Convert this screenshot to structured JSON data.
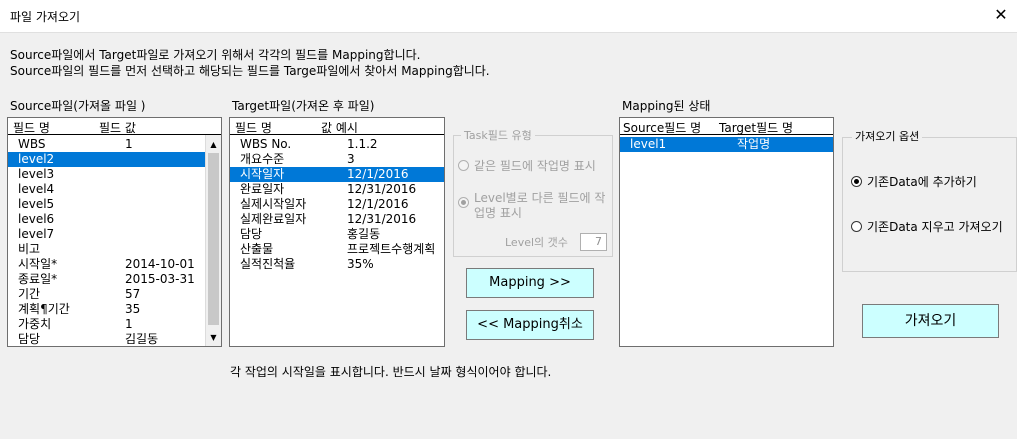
{
  "window": {
    "title": "파일 가져오기",
    "close_glyph": "✕"
  },
  "description": [
    "Source파일에서 Target파일로 가져오기 위해서 각각의 필드를 Mapping합니다.",
    "Source파일의 필드를 먼저 선택하고 해당되는 필드를 Targe파일에서 찾아서 Mapping합니다."
  ],
  "source": {
    "label": "Source파일(가져올 파일 )",
    "col_name": "필드 명",
    "col_value": "필드 값",
    "rows": [
      {
        "name": "WBS",
        "value": "1"
      },
      {
        "name": "level2",
        "value": ""
      },
      {
        "name": "level3",
        "value": ""
      },
      {
        "name": "level4",
        "value": ""
      },
      {
        "name": "level5",
        "value": ""
      },
      {
        "name": "level6",
        "value": ""
      },
      {
        "name": "level7",
        "value": ""
      },
      {
        "name": "비고",
        "value": ""
      },
      {
        "name": "시작일*",
        "value": "2014-10-01"
      },
      {
        "name": "종료일*",
        "value": "2015-03-31"
      },
      {
        "name": "기간",
        "value": "57"
      },
      {
        "name": "계획¶기간",
        "value": "35"
      },
      {
        "name": "가중치",
        "value": "1"
      },
      {
        "name": "담당",
        "value": "김길동"
      }
    ],
    "selected_index": 1
  },
  "target": {
    "label": "Target파일(가져온 후 파일)",
    "col_name": "필드 명",
    "col_value": "값 예시",
    "rows": [
      {
        "name": "WBS No.",
        "value": "1.1.2"
      },
      {
        "name": "개요수준",
        "value": "3"
      },
      {
        "name": "시작일자",
        "value": "12/1/2016"
      },
      {
        "name": "완료일자",
        "value": "12/31/2016"
      },
      {
        "name": "실제시작일자",
        "value": "12/1/2016"
      },
      {
        "name": "실제완료일자",
        "value": "12/31/2016"
      },
      {
        "name": "담당",
        "value": "홍길동"
      },
      {
        "name": "산출물",
        "value": "프로젝트수행계획"
      },
      {
        "name": "실적진척율",
        "value": "35%"
      }
    ],
    "selected_index": 2
  },
  "task_field_type": {
    "title": "Task필드 유형",
    "option1": "같은 필드에 작업명 표시",
    "option2_line1": "Level별로 다른 필드에 작",
    "option2_line2": "업명 표시",
    "level_count_label": "Level의 갯수",
    "level_count_value": "7"
  },
  "buttons": {
    "mapping": "Mapping >>",
    "unmapping": "<< Mapping취소",
    "import": "가져오기"
  },
  "mapped": {
    "label": "Mapping된 상태",
    "col_source": "Source필드 명",
    "col_target": "Target필드 명",
    "rows": [
      {
        "source": "level1",
        "target": "작업명"
      }
    ],
    "selected_index": 0
  },
  "import_options": {
    "title": "가져오기 옵션",
    "option_append": "기존Data에 추가하기",
    "option_replace": "기존Data 지우고 가져오기"
  },
  "status_text": "각 작업의 시작일을 표시합니다. 반드시 날짜 형식이어야 합니다."
}
